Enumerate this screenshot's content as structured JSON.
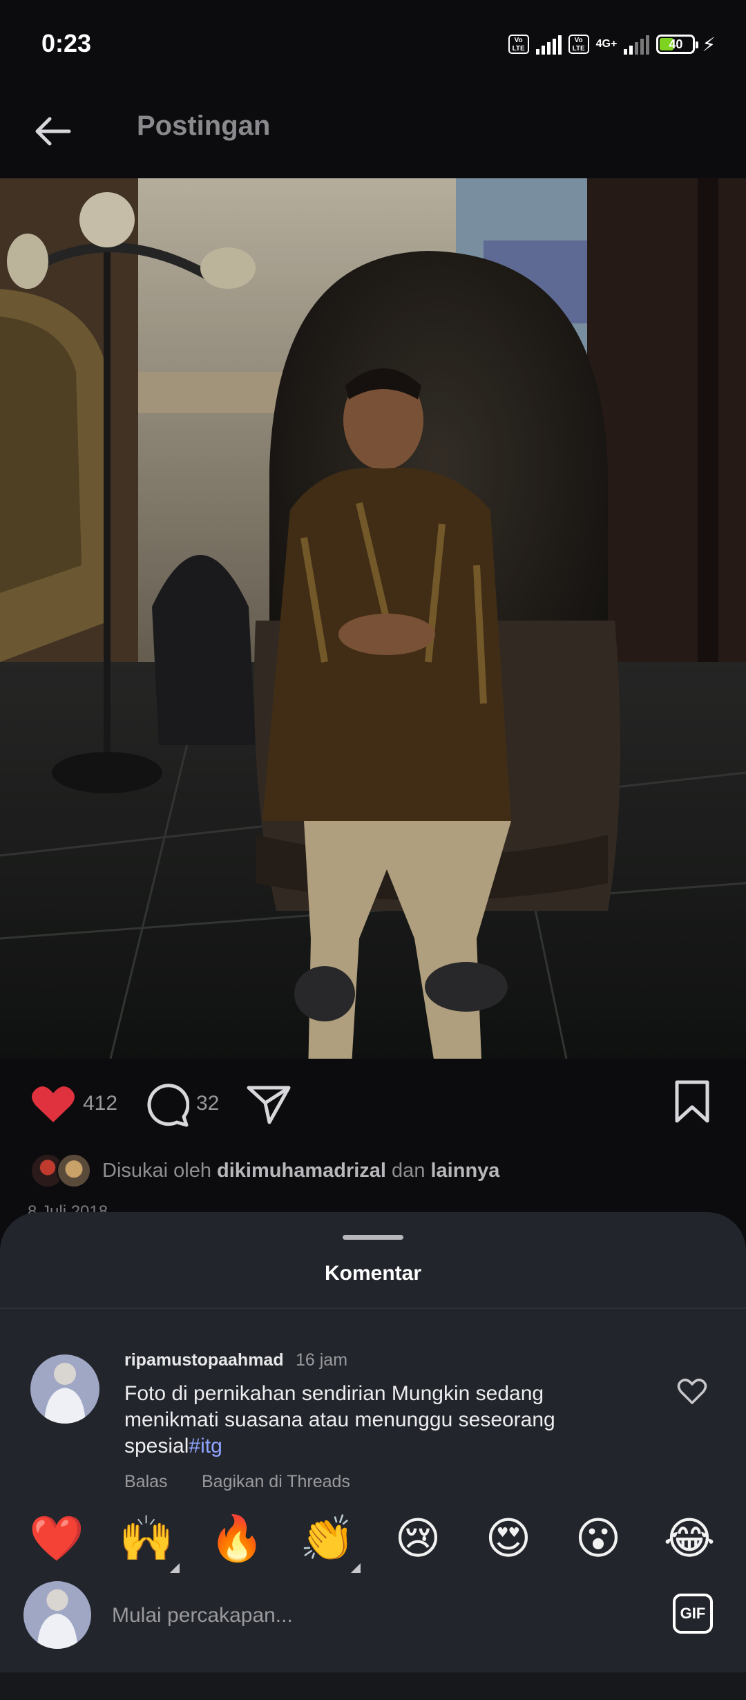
{
  "status": {
    "time": "0:23",
    "volte1": "Vo LTE",
    "volte2": "Vo LTE",
    "network": "4G+",
    "battery": "40"
  },
  "header": {
    "title": "Postingan"
  },
  "post": {
    "likes": "412",
    "comments": "32",
    "liked_by_prefix": "Disukai oleh ",
    "liked_by_user": "dikimuhamadrizal",
    "liked_by_and": " dan ",
    "liked_by_others": "lainnya",
    "date": "8 Juli 2018"
  },
  "sheet": {
    "title": "Komentar",
    "comment": {
      "username": "ripamustopaahmad",
      "time": "16 jam",
      "text": "Foto di pernikahan sendirian Mungkin sedang menikmati suasana atau menunggu seseorang spesial",
      "hashtag": "#itg",
      "reply_label": "Balas",
      "share_threads_label": "Bagikan di Threads"
    },
    "reactions": [
      "❤️",
      "🙌",
      "🔥",
      "👏",
      "😢",
      "😍",
      "😮",
      "😂"
    ],
    "input_placeholder": "Mulai percakapan...",
    "gif_label": "GIF"
  },
  "colors": {
    "heart": "#e0323e",
    "accent_link": "#8fa4ff",
    "sheet_bg": "#22252b"
  }
}
